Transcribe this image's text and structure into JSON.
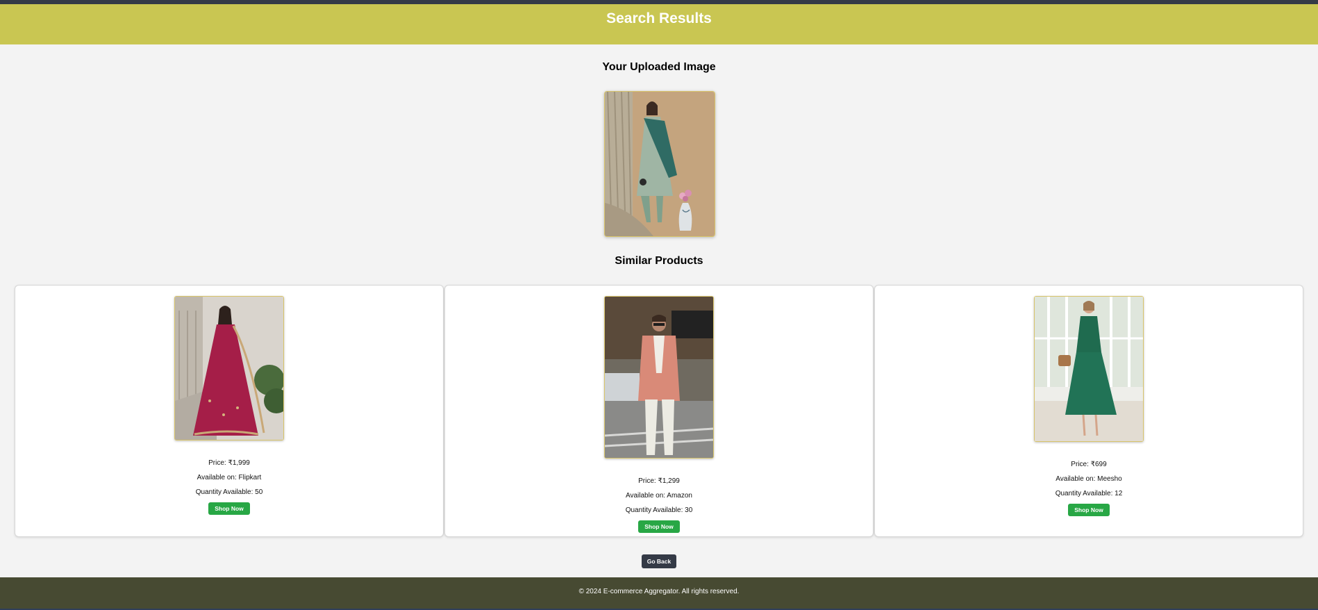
{
  "header": {
    "title": "Search Results"
  },
  "uploaded": {
    "title": "Your Uploaded Image",
    "image_alt": "woman-in-green-printed-anarkali-suit-photo"
  },
  "similar": {
    "title": "Similar Products",
    "products": [
      {
        "price": "Price: ₹1,999",
        "platform": "Available on: Flipkart",
        "quantity": "Quantity Available: 50",
        "button": "Shop Now",
        "image": "woman-in-maroon-gown-photo"
      },
      {
        "price": "Price: ₹1,299",
        "platform": "Available on: Amazon",
        "quantity": "Quantity Available: 30",
        "button": "Shop Now",
        "image": "man-in-peach-blazer-photo"
      },
      {
        "price": "Price: ₹699",
        "platform": "Available on: Meesho",
        "quantity": "Quantity Available: 12",
        "button": "Shop Now",
        "image": "woman-in-green-midi-dress-photo"
      }
    ]
  },
  "go_back": "Go Back",
  "footer": {
    "text": "© 2024 E-commerce Aggregator. All rights reserved."
  },
  "colors": {
    "header_bg": "#c9c652",
    "footer_bg": "#474a32",
    "shop_button": "#28a745",
    "back_button": "#343a46",
    "image_border": "#d8c46a"
  }
}
